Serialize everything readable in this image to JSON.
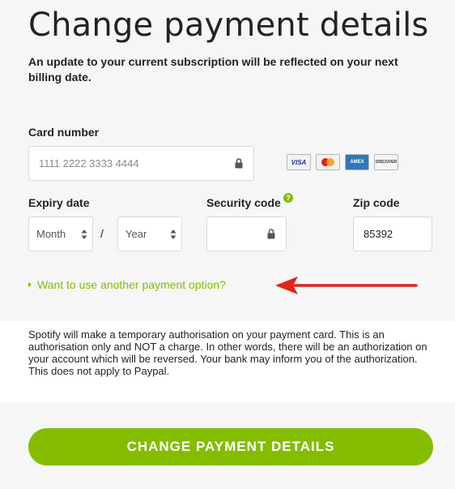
{
  "page": {
    "title": "Change payment details",
    "subtitle": "An update to your current subscription will be reflected on your next billing date."
  },
  "form": {
    "card_number": {
      "label": "Card number",
      "placeholder": "1111 2222 3333 4444",
      "lock_icon": "lock-icon"
    },
    "card_brands": [
      {
        "name": "VISA",
        "icon": "visa-logo"
      },
      {
        "name": "Mastercard",
        "icon": "mastercard-logo"
      },
      {
        "name": "AMEX",
        "icon": "amex-logo"
      },
      {
        "name": "DISCOVER",
        "icon": "discover-logo"
      }
    ],
    "expiry": {
      "label": "Expiry date",
      "month_placeholder": "Month",
      "year_placeholder": "Year",
      "separator": "/"
    },
    "security_code": {
      "label": "Security code",
      "help_icon": "?",
      "lock_icon": "lock-icon"
    },
    "zip": {
      "label": "Zip code",
      "value": "85392"
    },
    "alt_payment_link": "Want to use another payment option?"
  },
  "notice": "Spotify will make a temporary authorisation on your payment card. This is an authorisation only and NOT a charge. In other words, there will be an authorization on your account which will be reversed. Your bank may inform you of the authorization. This does not apply to Paypal.",
  "submit_button": "CHANGE PAYMENT DETAILS",
  "colors": {
    "accent": "#84bd00",
    "annotation_arrow": "#e0251b",
    "text": "#222326",
    "background": "#f6f6f6"
  }
}
